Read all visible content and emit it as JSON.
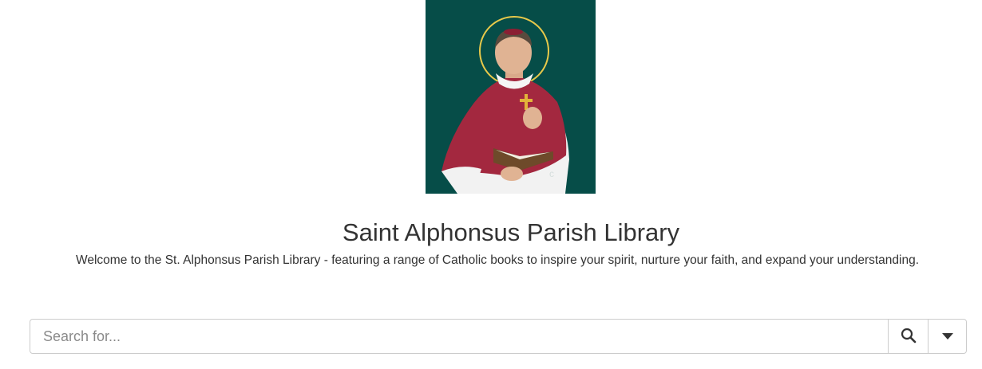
{
  "header": {
    "image_alt": "Saint Alphonsus image",
    "title": "Saint Alphonsus Parish Library",
    "welcome": "Welcome to the St. Alphonsus Parish Library - featuring a range of Catholic books to inspire your spirit, nurture your faith, and expand your understanding."
  },
  "search": {
    "placeholder": "Search for...",
    "value": "",
    "search_icon": "search-icon",
    "dropdown_icon": "caret-down-icon"
  },
  "colors": {
    "image_background": "#064d48",
    "text": "#333333",
    "border": "#cccccc"
  }
}
